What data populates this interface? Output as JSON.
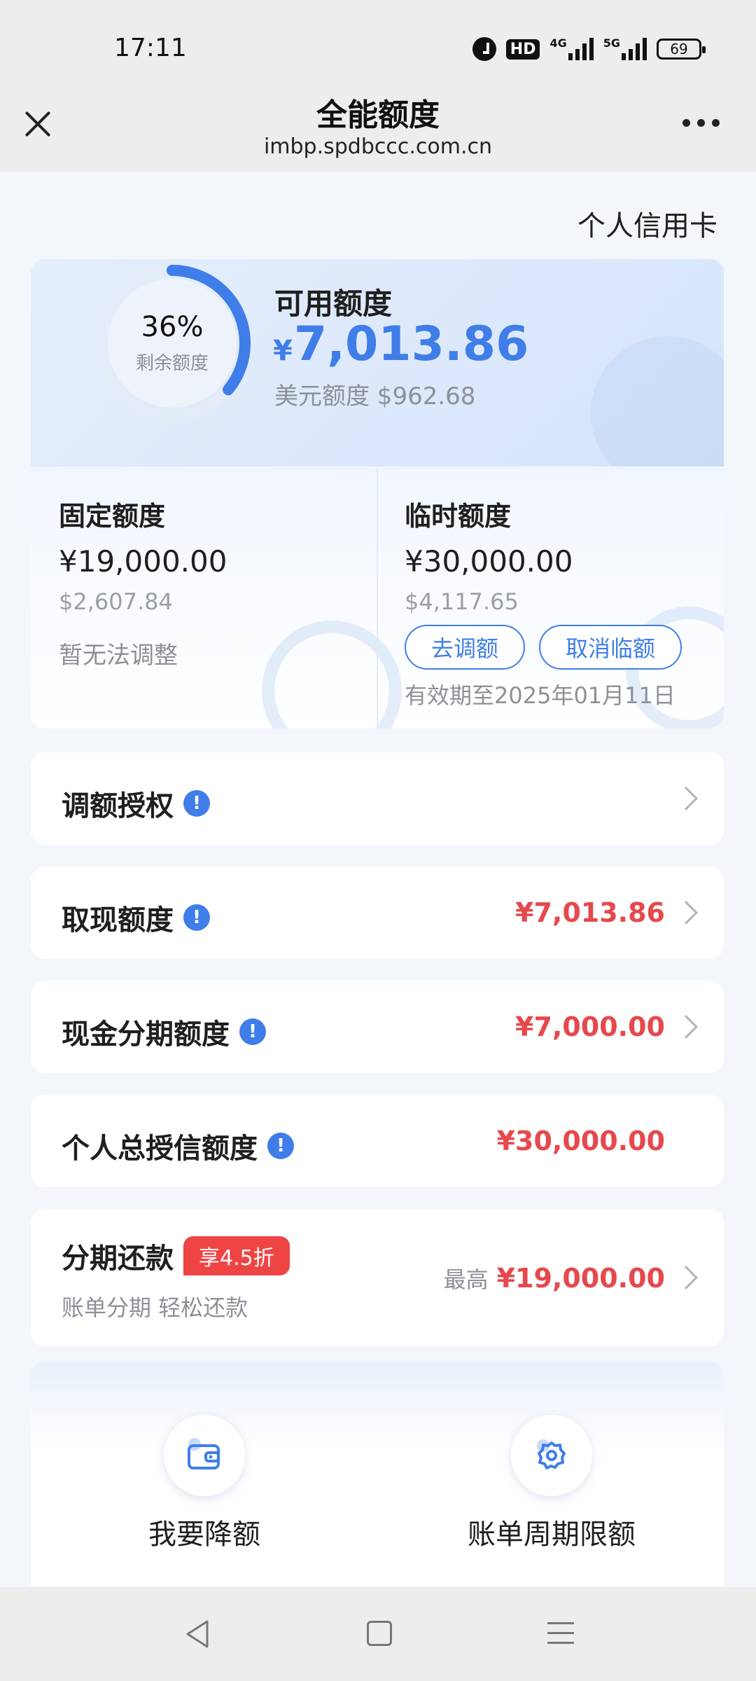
{
  "status_bar": {
    "time": "17:11",
    "hd": "HD",
    "net1": "4G",
    "net2": "5G",
    "battery": "69"
  },
  "header": {
    "title": "全能额度",
    "domain": "imbp.spdbccc.com.cn"
  },
  "card_type": "个人信用卡",
  "summary": {
    "ring_percent": "36%",
    "ring_label": "剩余额度",
    "ring_fraction": 0.36,
    "available_label": "可用额度",
    "currency_symbol": "¥",
    "available_amount": "7,013.86",
    "usd_line": "美元额度 $962.68"
  },
  "fixed": {
    "title": "固定额度",
    "cny": "¥19,000.00",
    "usd": "$2,607.84",
    "note": "暂无法调整"
  },
  "temp": {
    "title": "临时额度",
    "cny": "¥30,000.00",
    "usd": "$4,117.65",
    "adjust_button": "去调额",
    "cancel_button": "取消临额",
    "validity": "有效期至2025年01月11日"
  },
  "rows": {
    "authorize": {
      "label": "调额授权",
      "info": "!"
    },
    "cash": {
      "label": "取现额度",
      "info": "!",
      "value": "¥7,013.86"
    },
    "installment_cash": {
      "label": "现金分期额度",
      "info": "!",
      "value": "¥7,000.00"
    },
    "total_credit": {
      "label": "个人总授信额度",
      "info": "!",
      "value": "¥30,000.00"
    },
    "installment": {
      "label": "分期还款",
      "badge": "享4.5折",
      "sub": "账单分期 轻松还款",
      "max_label": "最高",
      "value": "¥19,000.00"
    }
  },
  "actions": {
    "reduce": {
      "label": "我要降额",
      "icon": "wallet-icon"
    },
    "cycle_limit": {
      "label": "账单周期限额",
      "icon": "gear-icon"
    }
  },
  "colors": {
    "accent": "#3f7ee8",
    "amount_red": "#e5484d",
    "badge_red": "#ef4444"
  }
}
